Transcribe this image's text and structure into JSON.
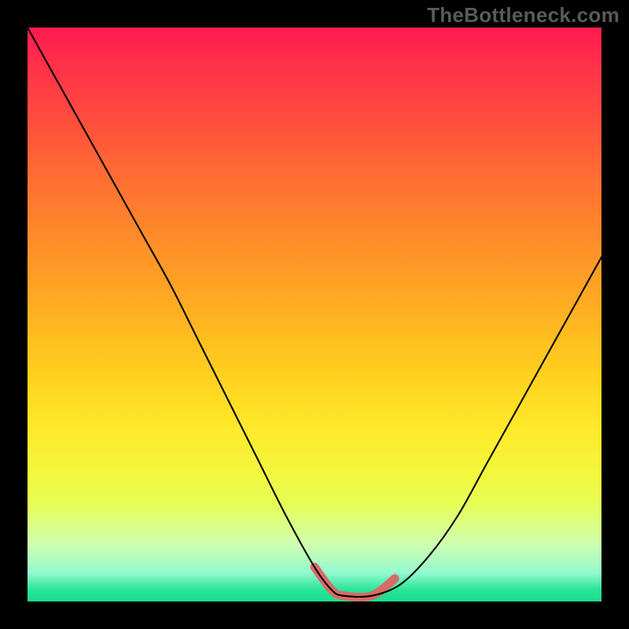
{
  "watermark": "TheBottleneck.com",
  "chart_data": {
    "type": "line",
    "title": "",
    "xlabel": "",
    "ylabel": "",
    "xlim": [
      0,
      100
    ],
    "ylim": [
      0,
      100
    ],
    "series": [
      {
        "name": "bottleneck-curve",
        "x": [
          0,
          5,
          10,
          15,
          20,
          25,
          30,
          35,
          40,
          45,
          50,
          53,
          55,
          60,
          65,
          70,
          75,
          80,
          85,
          90,
          95,
          100
        ],
        "y": [
          100,
          91,
          82,
          73,
          64,
          55,
          45,
          35,
          25,
          15,
          6,
          2,
          1,
          1,
          3,
          8,
          15,
          24,
          33,
          42,
          51,
          60
        ]
      }
    ],
    "highlight": {
      "description": "near-zero bottleneck region",
      "color": "#d86b65",
      "x": [
        50,
        53,
        55,
        60,
        64
      ],
      "y": [
        6,
        2,
        1,
        1,
        4
      ]
    },
    "background_gradient": {
      "direction": "vertical",
      "stops": [
        {
          "pos": 0,
          "color": "#ff1a51"
        },
        {
          "pos": 50,
          "color": "#ffab22"
        },
        {
          "pos": 80,
          "color": "#f2f83f"
        },
        {
          "pos": 100,
          "color": "#1cdc90"
        }
      ]
    }
  }
}
